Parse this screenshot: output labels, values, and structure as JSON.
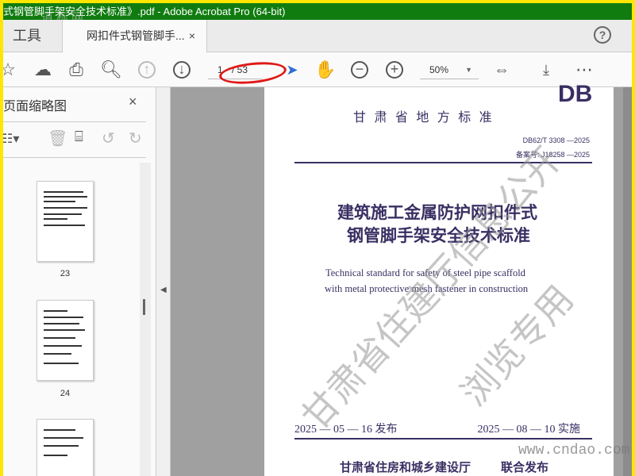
{
  "window": {
    "title": "式钢管脚手架安全技术标准》.pdf - Adobe Acrobat Pro (64-bit)",
    "overlay_logo": "道标网"
  },
  "tabs": {
    "tools": "工具",
    "document": "网扣件式钢管脚手...",
    "close": "×",
    "help": "?"
  },
  "toolbar": {
    "page_current": "1",
    "page_total": "/ 53",
    "zoom": "50%"
  },
  "sidebar": {
    "title": "页面缩略图",
    "close": "×",
    "thumbnails": [
      {
        "label": "23"
      },
      {
        "label": "24"
      }
    ]
  },
  "page": {
    "db": "DB",
    "authority": "甘 肃 省 地 方 标 准",
    "code": "DB62/T 3308 —2025",
    "record": "备案号: J18258 —2025",
    "title_line1": "建筑施工金属防护网扣件式",
    "title_line2": "钢管脚手架安全技术标准",
    "en_line1": "Technical standard for safety of steel pipe scaffold",
    "en_line2": "with metal protective mesh fastener in construction",
    "issue_date": "2025 — 05 — 16 发布",
    "impl_date": "2025 — 08 — 10 实施",
    "publisher": "甘肃省住房和城乡建设厅",
    "joint": "联合发布",
    "watermark1": "甘肃省住建厅信息公开",
    "watermark2": "浏览专用",
    "site_watermark": "www.cndao.com"
  }
}
